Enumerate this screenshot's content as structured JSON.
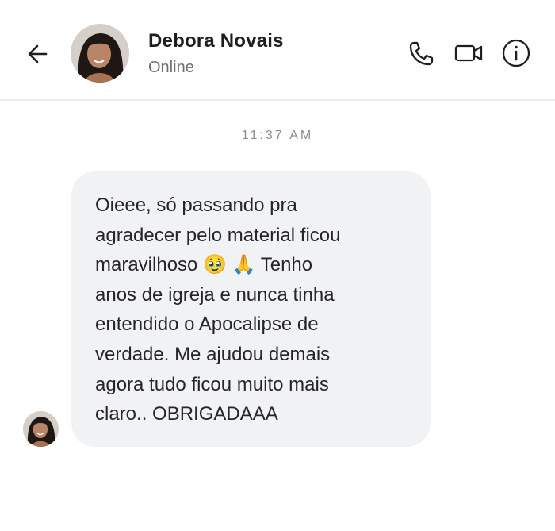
{
  "header": {
    "back_icon": "arrow-left-icon",
    "contact_name": "Debora Novais",
    "contact_status": "Online",
    "actions": [
      {
        "icon": "phone-icon",
        "label": "call"
      },
      {
        "icon": "video-camera-icon",
        "label": "video call"
      },
      {
        "icon": "info-icon",
        "label": "info"
      }
    ]
  },
  "conversation": {
    "timestamp": "11:37 AM",
    "messages": [
      {
        "sender": "Debora Novais",
        "lines": [
          "Oieee, só passando pra",
          "agradecer pelo material ficou",
          "maravilhoso 🥹 🙏 Tenho",
          "anos de igreja e nunca tinha",
          "entendido o Apocalipse de",
          "verdade. Me ajudou demais",
          "agora tudo ficou muito mais",
          "claro.. OBRIGADAAA"
        ]
      }
    ]
  },
  "colors": {
    "bubble_bg": "#f1f2f4",
    "text": "#262626",
    "status": "#6f6f6f",
    "divider": "#ececec"
  }
}
